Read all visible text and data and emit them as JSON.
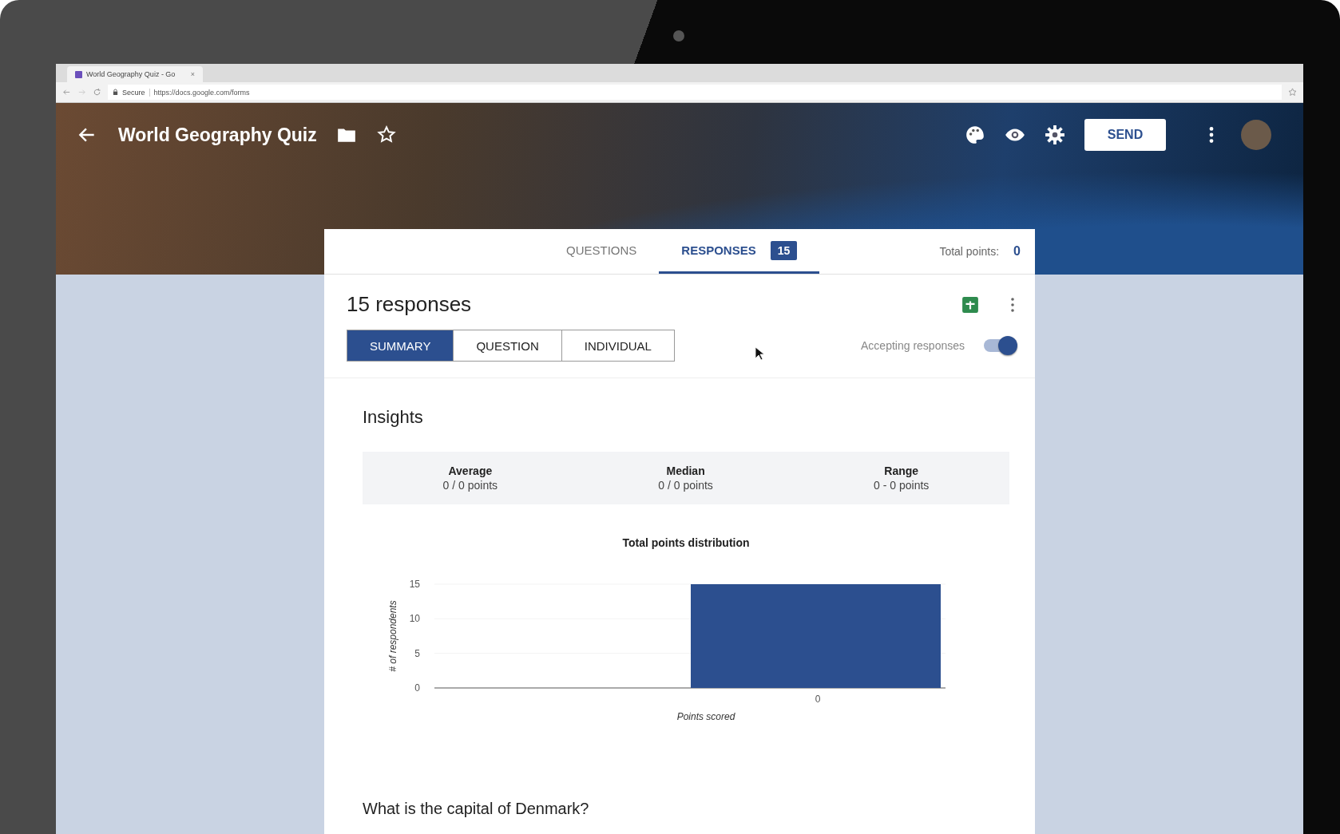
{
  "browser": {
    "tab_title": "World Geography Quiz - Go",
    "tab_close": "×",
    "secure_label": "Secure",
    "url": "https://docs.google.com/forms"
  },
  "header": {
    "title": "World Geography Quiz",
    "send_label": "SEND"
  },
  "tabs": [
    {
      "label": "QUESTIONS",
      "selected": false
    },
    {
      "label": "RESPONSES",
      "badge": "15",
      "selected": true
    }
  ],
  "total_points": {
    "label": "Total points:",
    "value": "0"
  },
  "responses": {
    "heading": "15 responses",
    "views": [
      {
        "label": "SUMMARY",
        "selected": true
      },
      {
        "label": "QUESTION",
        "selected": false
      },
      {
        "label": "INDIVIDUAL",
        "selected": false
      }
    ],
    "accepting": {
      "label": "Accepting responses",
      "on": true
    }
  },
  "insights": {
    "title": "Insights",
    "stats": [
      {
        "label": "Average",
        "value": "0 / 0 points"
      },
      {
        "label": "Median",
        "value": "0 / 0 points"
      },
      {
        "label": "Range",
        "value": "0 - 0 points"
      }
    ],
    "chart_data": {
      "type": "bar",
      "title": "Total points distribution",
      "xlabel": "Points scored",
      "ylabel": "# of respondents",
      "categories": [
        "0"
      ],
      "series": [
        {
          "color": "#2c4f8f",
          "values": [
            15
          ]
        }
      ],
      "ylim": [
        0,
        15
      ],
      "yticks": [
        0,
        5,
        10,
        15
      ]
    }
  },
  "question": {
    "text": "What is the capital of Denmark?"
  }
}
